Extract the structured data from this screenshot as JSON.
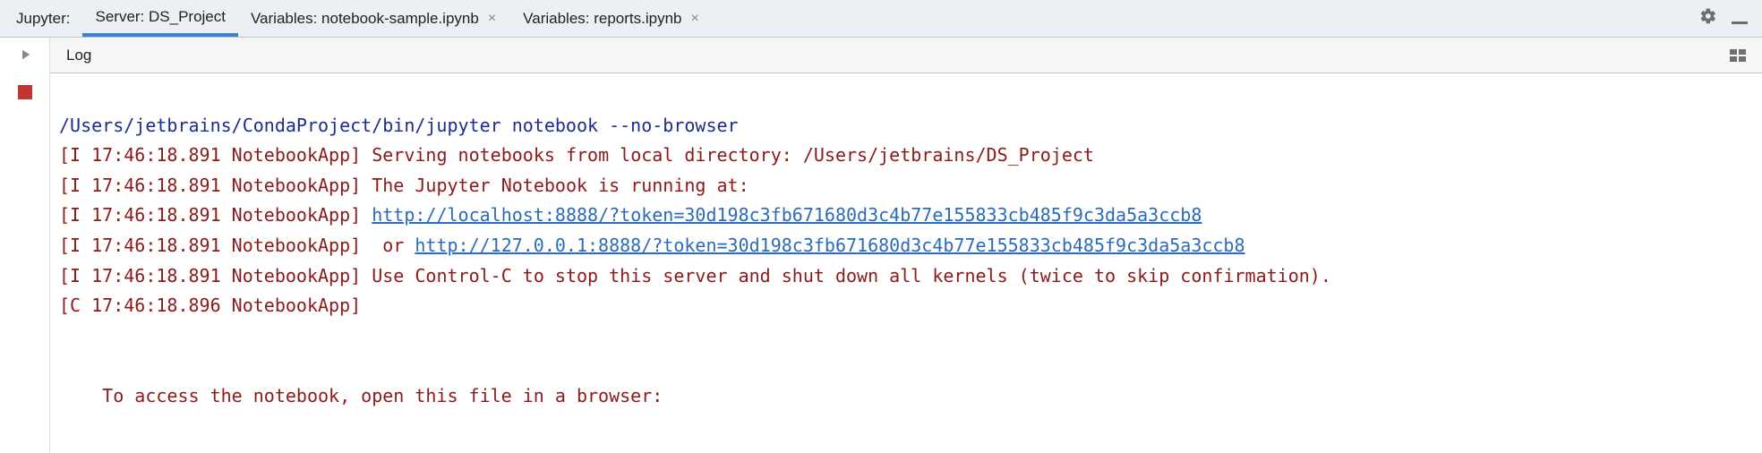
{
  "header": {
    "prefix": "Jupyter:",
    "tabs": [
      {
        "label": "Server: DS_Project",
        "closable": false,
        "active": true
      },
      {
        "label": "Variables: notebook-sample.ipynb",
        "closable": true,
        "active": false
      },
      {
        "label": "Variables: reports.ipynb",
        "closable": true,
        "active": false
      }
    ]
  },
  "subheader": {
    "tab": "Log"
  },
  "log": {
    "command": "/Users/jetbrains/CondaProject/bin/jupyter notebook --no-browser",
    "lines": [
      {
        "prefix": "[I 17:46:18.891 NotebookApp] ",
        "text": "Serving notebooks from local directory: /Users/jetbrains/DS_Project"
      },
      {
        "prefix": "[I 17:46:18.891 NotebookApp] ",
        "text": "The Jupyter Notebook is running at:"
      },
      {
        "prefix": "[I 17:46:18.891 NotebookApp] ",
        "link": "http://localhost:8888/?token=30d198c3fb671680d3c4b77e155833cb485f9c3da5a3ccb8"
      },
      {
        "prefix": "[I 17:46:18.891 NotebookApp]  ",
        "pretext": "or ",
        "link": "http://127.0.0.1:8888/?token=30d198c3fb671680d3c4b77e155833cb485f9c3da5a3ccb8"
      },
      {
        "prefix": "[I 17:46:18.891 NotebookApp] ",
        "text": "Use Control-C to stop this server and shut down all kernels (twice to skip confirmation)."
      },
      {
        "prefix": "[C 17:46:18.896 NotebookApp]",
        "text": ""
      }
    ],
    "trailer": "    To access the notebook, open this file in a browser:"
  }
}
